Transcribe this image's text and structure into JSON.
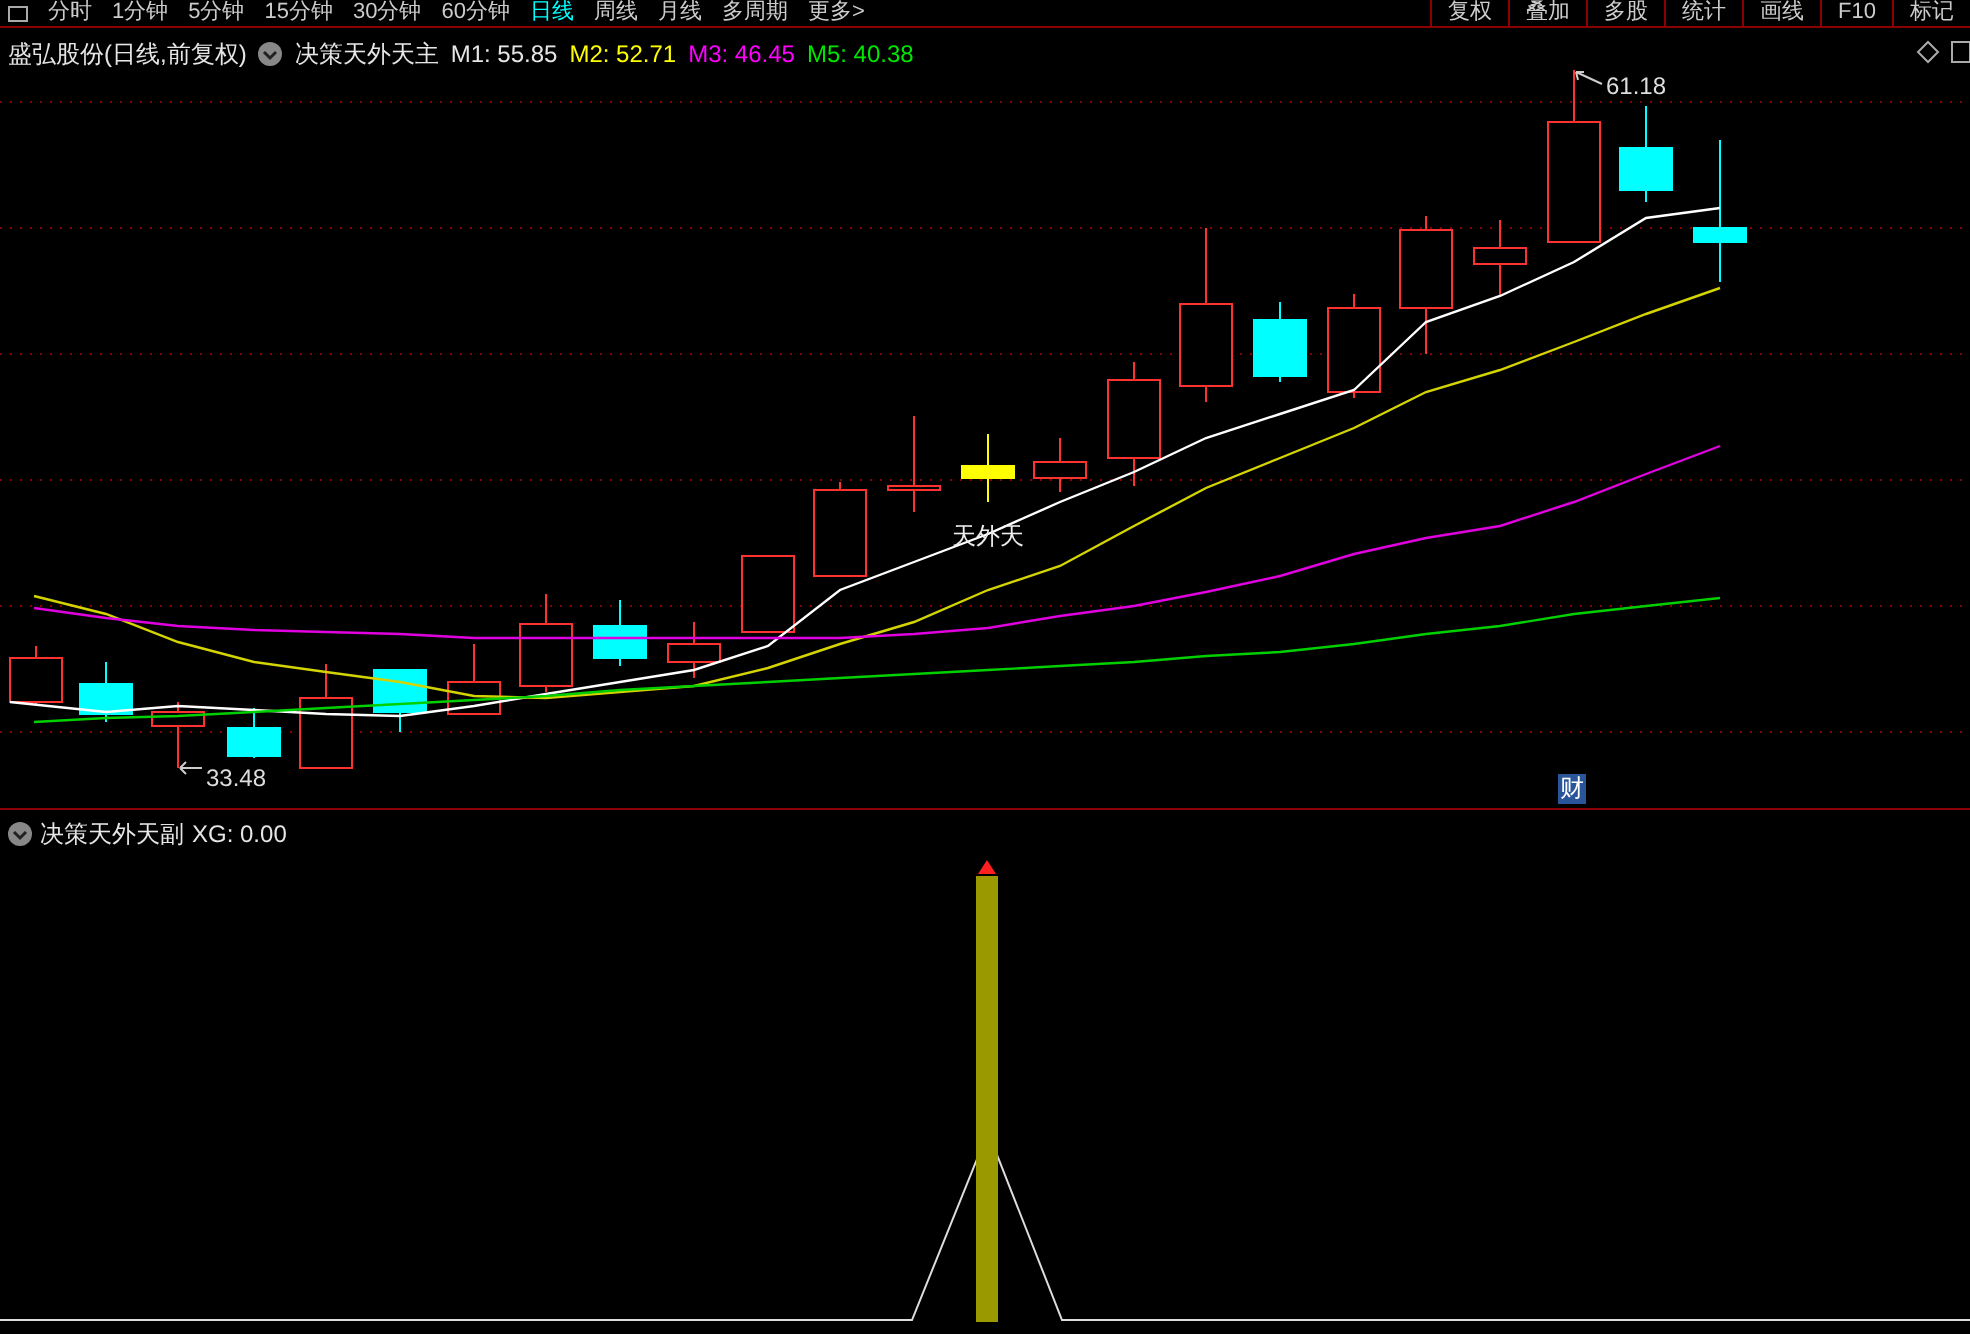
{
  "toolbar": {
    "tabs": [
      {
        "label": "分时",
        "selected": false
      },
      {
        "label": "1分钟",
        "selected": false
      },
      {
        "label": "5分钟",
        "selected": false
      },
      {
        "label": "15分钟",
        "selected": false
      },
      {
        "label": "30分钟",
        "selected": false
      },
      {
        "label": "60分钟",
        "selected": false
      },
      {
        "label": "日线",
        "selected": true
      },
      {
        "label": "周线",
        "selected": false
      },
      {
        "label": "月线",
        "selected": false
      },
      {
        "label": "多周期",
        "selected": false
      },
      {
        "label": "更多>",
        "selected": false
      }
    ],
    "tools": [
      "复权",
      "叠加",
      "多股",
      "统计",
      "画线",
      "F10",
      "标记"
    ]
  },
  "main_panel": {
    "stock_title": "盛弘股份(日线,前复权)",
    "indicator": "决策天外天主",
    "ma_readings": [
      {
        "label": "M1: 55.85",
        "color": "#e6e6e6"
      },
      {
        "label": "M2: 52.71",
        "color": "#ffff00"
      },
      {
        "label": "M3: 46.45",
        "color": "#ff00ff"
      },
      {
        "label": "M5: 40.38",
        "color": "#00e600"
      }
    ],
    "high_label": "61.18",
    "low_label": "33.48",
    "signal_label": "天外天",
    "event_badge": "财"
  },
  "sub_panel": {
    "indicator": "决策天外天副",
    "reading": "XG: 0.00"
  }
}
